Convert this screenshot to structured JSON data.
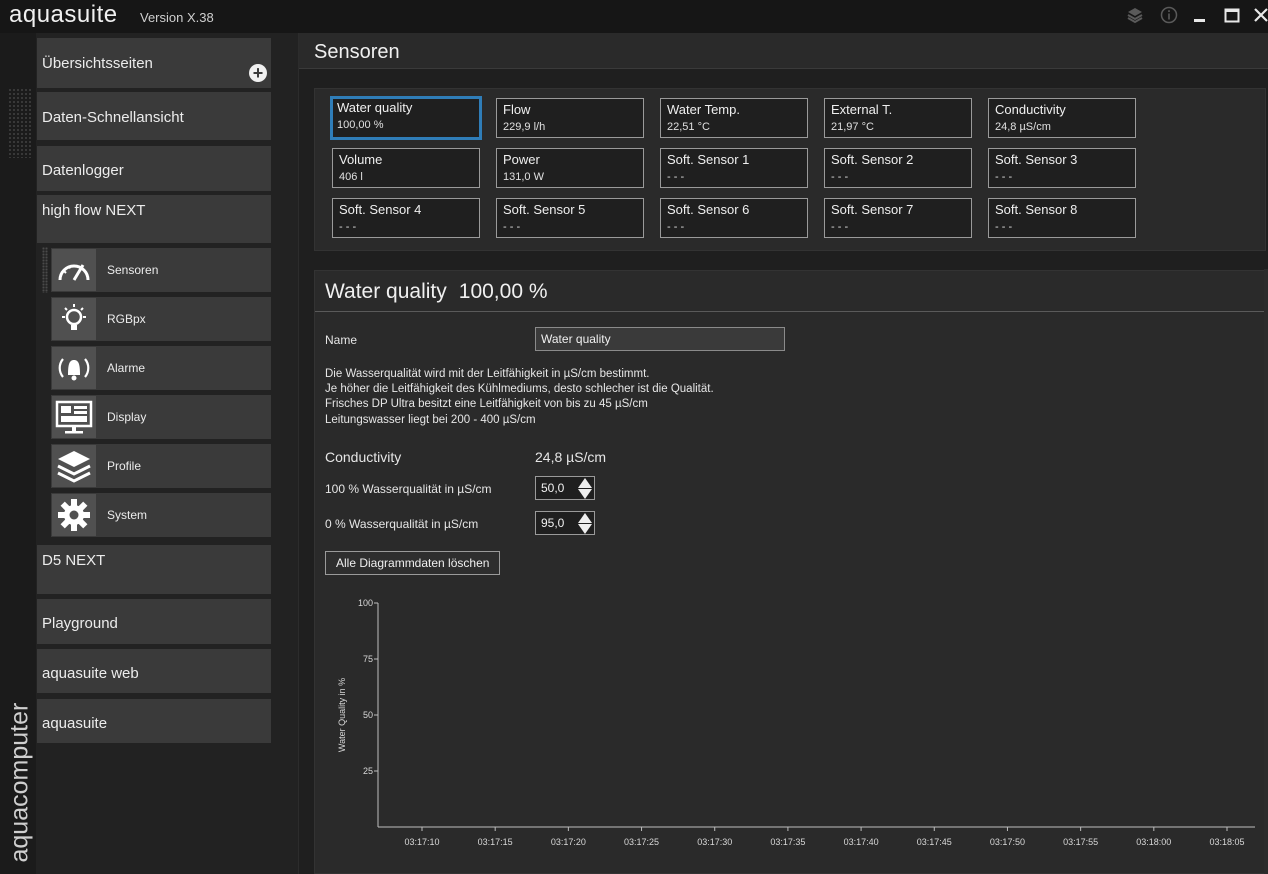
{
  "app": {
    "name": "aquasuite",
    "version": "Version X.38",
    "brand_vertical": "aquacomputer"
  },
  "window_controls": [
    "layers-icon",
    "info-icon",
    "minimize-icon",
    "maximize-icon",
    "close-icon"
  ],
  "sidebar": {
    "overview": "Übersichtsseiten",
    "quickview": "Daten-Schnellansicht",
    "datalogger": "Datenlogger",
    "device": "high flow NEXT",
    "sub_items": [
      {
        "label": "Sensoren",
        "icon": "gauge-icon"
      },
      {
        "label": "RGBpx",
        "icon": "lightbulb-icon"
      },
      {
        "label": "Alarme",
        "icon": "alarm-bell-icon"
      },
      {
        "label": "Display",
        "icon": "display-icon"
      },
      {
        "label": "Profile",
        "icon": "layers-icon"
      },
      {
        "label": "System",
        "icon": "gear-icon"
      }
    ],
    "d5": "D5 NEXT",
    "playground": "Playground",
    "web": "aquasuite web",
    "aquasuite": "aquasuite"
  },
  "main": {
    "title": "Sensoren",
    "tiles": [
      {
        "name": "Water quality",
        "value": "100,00 %"
      },
      {
        "name": "Flow",
        "value": "229,9 l/h"
      },
      {
        "name": "Water Temp.",
        "value": "22,51 °C"
      },
      {
        "name": "External T.",
        "value": "21,97 °C"
      },
      {
        "name": "Conductivity",
        "value": "24,8 µS/cm"
      },
      {
        "name": "Volume",
        "value": "406 l"
      },
      {
        "name": "Power",
        "value": "131,0 W"
      },
      {
        "name": "Soft. Sensor 1",
        "value": "- - -"
      },
      {
        "name": "Soft. Sensor 2",
        "value": "- - -"
      },
      {
        "name": "Soft. Sensor 3",
        "value": "- - -"
      },
      {
        "name": "Soft. Sensor 4",
        "value": "- - -"
      },
      {
        "name": "Soft. Sensor 5",
        "value": "- - -"
      },
      {
        "name": "Soft. Sensor 6",
        "value": "- - -"
      },
      {
        "name": "Soft. Sensor 7",
        "value": "- - -"
      },
      {
        "name": "Soft. Sensor 8",
        "value": "- - -"
      }
    ],
    "selected_tile": "Water quality",
    "detail": {
      "title": "Water quality",
      "title_value": "100,00 %",
      "name_label": "Name",
      "name_value": "Water quality",
      "description": [
        "Die Wasserqualität wird mit der Leitfähigkeit in µS/cm bestimmt.",
        "Je höher die Leitfähigkeit des Kühlmediums, desto schlecher ist die Qualität.",
        "Frisches DP Ultra besitzt eine Leitfähigkeit von bis zu 45 µS/cm",
        "Leitungswasser liegt bei 200 - 400 µS/cm"
      ],
      "conductivity_label": "Conductivity",
      "conductivity_value": "24,8 µS/cm",
      "q100_label": "100 % Wasserqualität in µS/cm",
      "q100_value": "50,0",
      "q0_label": "0 % Wasserqualität in µS/cm",
      "q0_value": "95,0",
      "clear_button": "Alle Diagrammdaten löschen"
    }
  },
  "chart_data": {
    "type": "line",
    "ylabel": "Water Quality in %",
    "xlabel": "",
    "yticks": [
      "25",
      "50",
      "75",
      "100"
    ],
    "ylim": [
      0,
      100
    ],
    "x": [
      "03:17:10",
      "03:17:15",
      "03:17:20",
      "03:17:25",
      "03:17:30",
      "03:17:35",
      "03:17:40",
      "03:17:45",
      "03:17:50",
      "03:17:55",
      "03:18:00",
      "03:18:05"
    ],
    "series": [],
    "grid": false,
    "colors": {
      "axis": "#bdbdbd",
      "text": "#d8d8d8"
    }
  }
}
